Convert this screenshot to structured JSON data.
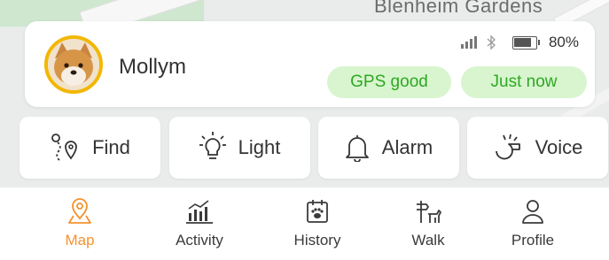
{
  "map": {
    "label": "Blenheim Gardens"
  },
  "pet": {
    "name": "Mollym",
    "battery": "80%",
    "gps_status": "GPS good",
    "last_update": "Just now"
  },
  "actions": [
    {
      "label": "Find",
      "icon": "route-pin-icon"
    },
    {
      "label": "Light",
      "icon": "lightbulb-icon"
    },
    {
      "label": "Alarm",
      "icon": "bell-icon"
    },
    {
      "label": "Voice",
      "icon": "whistle-icon"
    }
  ],
  "tabs": [
    {
      "label": "Map",
      "icon": "map-pin-icon",
      "active": true
    },
    {
      "label": "Activity",
      "icon": "bar-chart-icon",
      "active": false
    },
    {
      "label": "History",
      "icon": "calendar-paw-icon",
      "active": false
    },
    {
      "label": "Walk",
      "icon": "dog-signpost-icon",
      "active": false
    },
    {
      "label": "Profile",
      "icon": "user-icon",
      "active": false
    }
  ],
  "colors": {
    "accent": "#f5922e",
    "pill_bg": "#d8f5cf",
    "pill_text": "#2ea823",
    "avatar_ring": "#f2b705"
  }
}
